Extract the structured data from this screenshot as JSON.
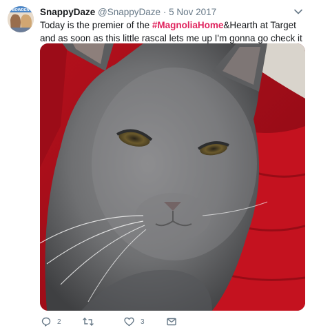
{
  "tweet": {
    "display_name": "SnappyDaze",
    "handle": "@SnappyDaze",
    "separator": "·",
    "date": "5 Nov 2017",
    "text_before": "Today is the premier of the ",
    "hashtag": "#MagnoliaHome",
    "text_after": "&Hearth at Target and as soon as this little rascal lets me up I'm gonna go check it out.",
    "avatar_badge": "BOWDEN"
  },
  "actions": {
    "reply_count": "2",
    "retweet_count": "",
    "like_count": "3"
  },
  "icons": {
    "reply": "reply-icon",
    "retweet": "retweet-icon",
    "like": "heart-icon",
    "message": "envelope-icon",
    "more": "chevron-down-icon"
  },
  "colors": {
    "hashtag": "#e0245e",
    "muted": "#657786",
    "text": "#14171a"
  }
}
